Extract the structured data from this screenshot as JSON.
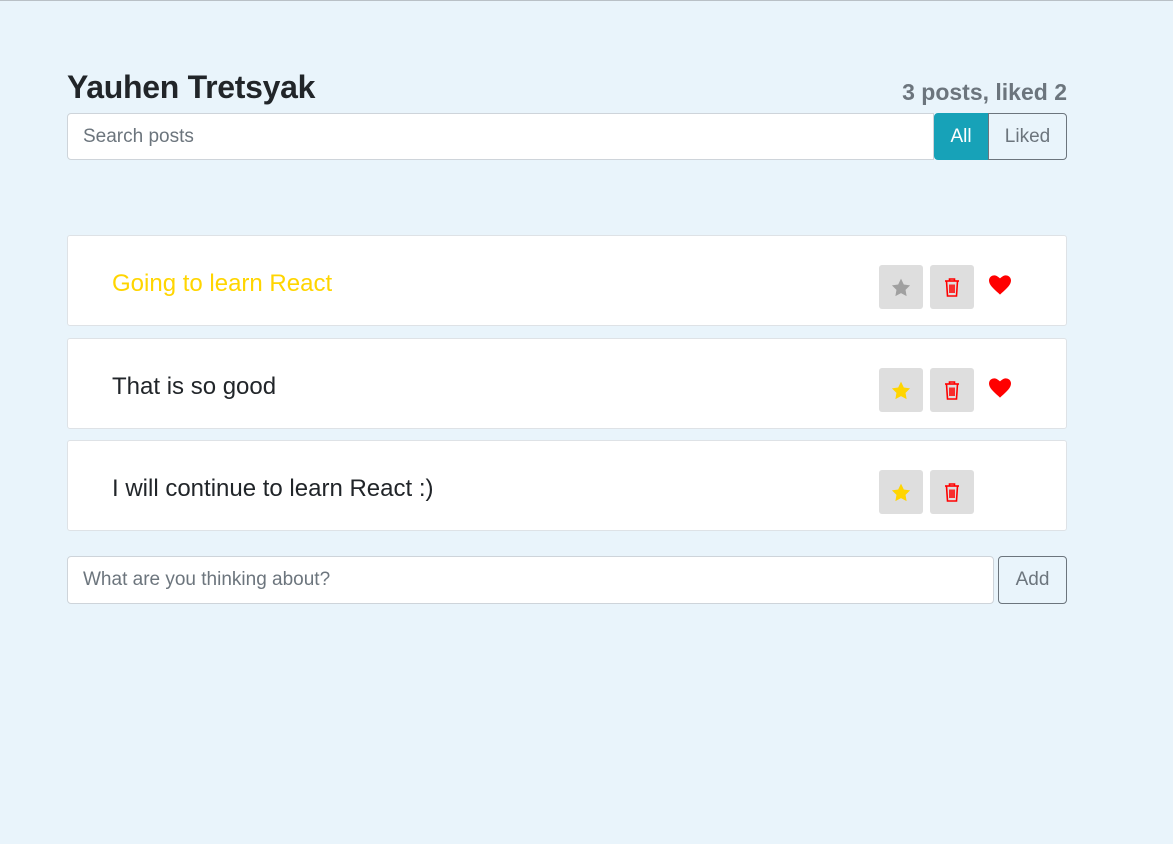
{
  "header": {
    "title": "Yauhen Tretsyak",
    "stats": "3 posts, liked 2"
  },
  "search": {
    "placeholder": "Search posts",
    "value": ""
  },
  "filters": {
    "all_label": "All",
    "liked_label": "Liked",
    "active": "All"
  },
  "posts": [
    {
      "label": "Going to learn React",
      "important": true,
      "liked": true,
      "star_color": "#a0a0a0",
      "star_icon": "star-icon"
    },
    {
      "label": "That is so good",
      "important": false,
      "liked": true,
      "star_color": "#ffd500",
      "star_icon": "star-icon"
    },
    {
      "label": "I will continue to learn React :)",
      "important": false,
      "liked": false,
      "star_color": "#ffd500",
      "star_icon": "star-icon"
    }
  ],
  "add_form": {
    "placeholder": "What are you thinking about?",
    "value": "",
    "button_label": "Add"
  },
  "colors": {
    "accent": "#17a2b8",
    "important_text": "#ffd500",
    "trash": "#ff0000",
    "heart": "#ff0000",
    "background": "#e9f4fb"
  }
}
